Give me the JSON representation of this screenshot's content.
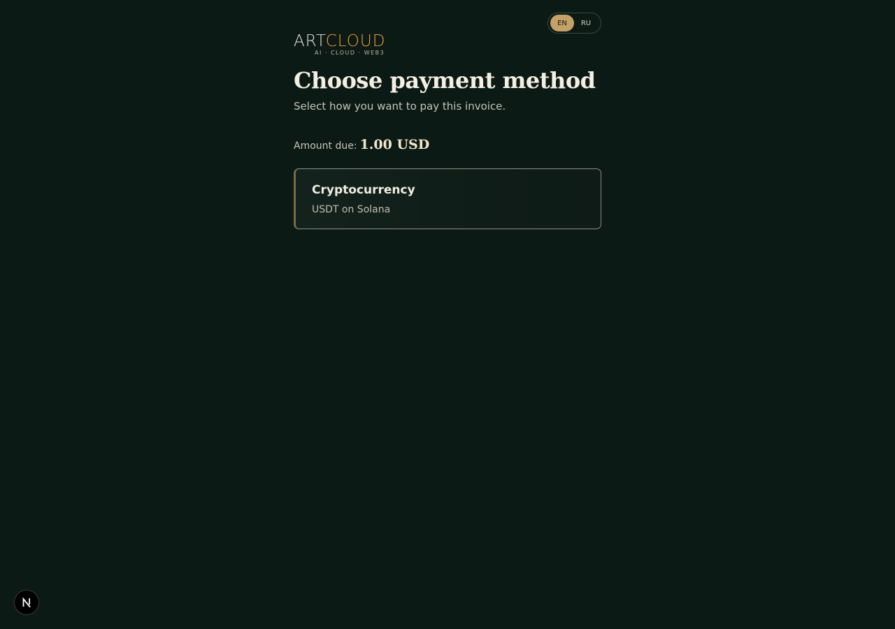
{
  "language_switcher": {
    "options": [
      "EN",
      "RU"
    ],
    "selected": "EN"
  },
  "logo": {
    "word_part1": "ART",
    "word_part2": "CLOUD",
    "tagline": "AI · CLOUD · WEB3",
    "colors": {
      "art": "#e6e3dc",
      "cloud": "#e8a037"
    }
  },
  "header": {
    "title": "Choose payment method",
    "subtitle": "Select how you want to pay this invoice."
  },
  "amount": {
    "label": "Amount due:",
    "value": "1.00 USD"
  },
  "payment_methods": [
    {
      "title": "Cryptocurrency",
      "subtitle": "USDT on Solana"
    }
  ],
  "dev_badge": {
    "icon": "nextjs-icon"
  },
  "colors": {
    "background": "#0c1a16",
    "accent": "#c4a166",
    "title": "#f4efe2"
  }
}
